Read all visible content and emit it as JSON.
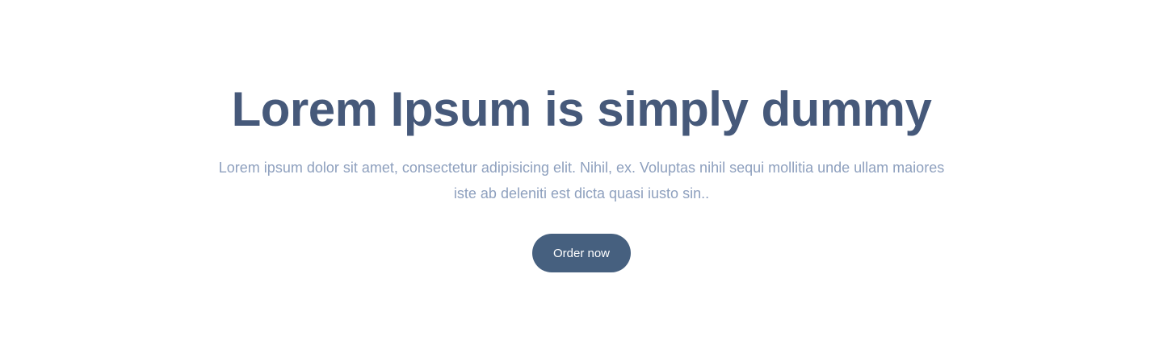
{
  "hero": {
    "title": "Lorem Ipsum is simply dummy",
    "description": "Lorem ipsum dolor sit amet, consectetur adipisicing elit. Nihil, ex. Voluptas nihil sequi mollitia unde ullam maiores iste ab deleniti est dicta quasi iusto sin..",
    "cta_label": "Order now"
  },
  "colors": {
    "title": "#46597a",
    "description": "#8ea0be",
    "button": "#46607f"
  }
}
